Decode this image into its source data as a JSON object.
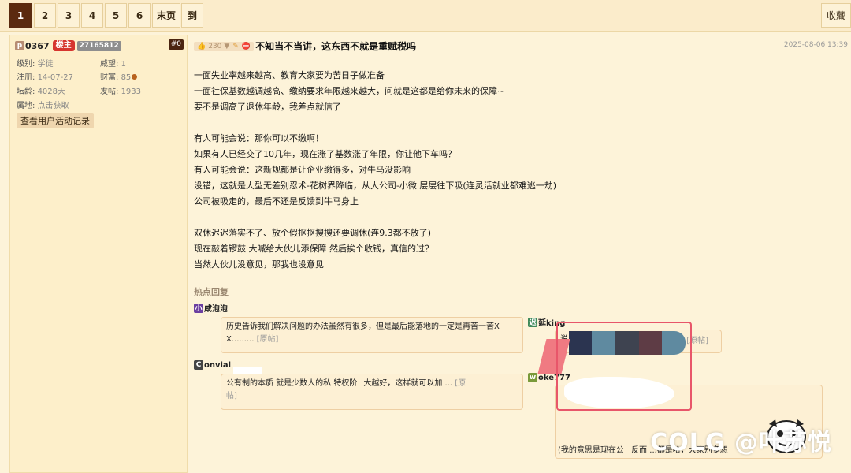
{
  "pager": {
    "pages": [
      "1",
      "2",
      "3",
      "4",
      "5",
      "6"
    ],
    "last": "末页",
    "goto": "到",
    "favorite": "收藏"
  },
  "user": {
    "avatar_letter": "p",
    "name": "0367",
    "host_tag": "楼主",
    "uid": "27165812",
    "floor": "#0",
    "level_label": "级别:",
    "level": "学徒",
    "prestige_label": "威望:",
    "prestige": "1",
    "reg_label": "注册:",
    "reg": "14-07-27",
    "wealth_label": "财富:",
    "wealth": "85",
    "age_label": "坛龄:",
    "age": "4028天",
    "posts_label": "发帖:",
    "posts": "1933",
    "loc_label": "属地:",
    "loc": "点击获取",
    "record_button": "查看用户活动记录"
  },
  "post": {
    "likes": "230",
    "title": "不知当不当讲，这东西不就是重赋税吗",
    "time": "2025-08-06 13:39",
    "lines": [
      "一面失业率越来越高、教育大家要为苦日子做准备",
      "一面社保基数越调越高、缴纳要求年限越来越大，问就是这都是给你未来的保障~",
      "要不是调高了退休年龄，我差点就信了",
      "",
      "有人可能会说：那你可以不缴啊！",
      "如果有人已经交了10几年，现在涨了基数涨了年限，你让他下车吗？",
      "有人可能会说：这新规都是让企业缴得多，对牛马没影响",
      "没错，这就是大型无差别忍术-花树界降临，从大公司-小微 层层往下吸(连灵活就业都难逃一劫)",
      "公司被吸走的，最后不还是反馈到牛马身上",
      "",
      "双休迟迟落实不了、放个假抠抠搜搜还要调休(连9.3都不放了)",
      "现在敲着锣鼓 大喊给大伙儿添保障 然后挨个收钱，真信的过？",
      "当然大伙儿没意见，那我也没意见"
    ]
  },
  "hot": {
    "title": "热点回复",
    "r1_user_icon": "小",
    "r1_user": "咸泡泡",
    "r1_text1": "历史告诉我们解决问题的办法虽然有很多，但是最后能落地的一定是再苦一苦X",
    "r1_text2": "X.........",
    "r1_orig": "[原帖]",
    "r2_user_icon": "C",
    "r2_user": "onvial",
    "r2_text1": "公有制的本质 就是少数人的私          特权阶",
    "r2_text1b": "大越好，这样就可以加",
    "r2_dots": "...",
    "r2_orig": "[原",
    "r2_text2": "帖]",
    "r3_user_icon": "迟",
    "r3_user": "延king",
    "r3_text": "说",
    "r3_orig": "[原帖]",
    "r4_user_icon": "w",
    "r4_user": "oke777",
    "r4_text": "(我的意思是现在公",
    "r4_text_b": "反而   ...都是哈，大家别多想",
    "watermark": "COLG @叶苏悦"
  },
  "colors": {
    "accent": "#5b2a0f",
    "host_tag": "#d6352f",
    "frame": "#e8566a"
  }
}
